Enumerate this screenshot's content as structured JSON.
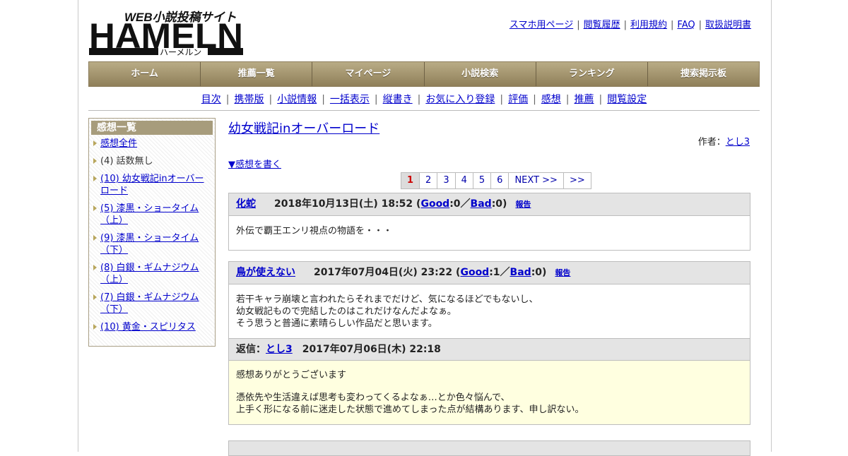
{
  "logo": {
    "text": "HAMELN",
    "tagline": "WEB小説投稿サイト",
    "kana": "ハーメルン"
  },
  "top_links": [
    "スマホ用ページ",
    "閲覧履歴",
    "利用規約",
    "FAQ",
    "取扱説明書"
  ],
  "global_nav": [
    "ホーム",
    "推薦一覧",
    "マイページ",
    "小説検索",
    "ランキング",
    "捜索掲示板"
  ],
  "sub_nav": [
    "目次",
    "携帯版",
    "小説情報",
    "一括表示",
    "縦書き",
    "お気に入り登録",
    "評価",
    "感想",
    "推薦",
    "閲覧設定"
  ],
  "sidebar": {
    "title": "感想一覧",
    "items": [
      {
        "label": "感想全件",
        "link": true
      },
      {
        "label": "(4) 話数無し",
        "link": false
      },
      {
        "label": "(10) 幼女戦記inオーバーロード",
        "link": true
      },
      {
        "label": "(5) 漆黒・ショータイム（上）",
        "link": true
      },
      {
        "label": "(9) 漆黒・ショータイム（下）",
        "link": true
      },
      {
        "label": "(8) 白銀・ギムナジウム（上）",
        "link": true
      },
      {
        "label": "(7) 白銀・ギムナジウム（下）",
        "link": true
      },
      {
        "label": "(10) 黄金・スピリタス",
        "link": true
      }
    ]
  },
  "main": {
    "novel_title": "幼女戦記inオーバーロード",
    "author_label": "作者：",
    "author_name": "とし3",
    "write_review": "▼感想を書く",
    "pager": [
      "1",
      "2",
      "3",
      "4",
      "5",
      "6",
      "NEXT >>",
      ">>"
    ],
    "pager_current": "1"
  },
  "reviews": [
    {
      "user": "化蛇",
      "date": "2018年10月13日(土) 18:52",
      "good_label": "Good",
      "good_count": ":0／",
      "bad_label": "Bad",
      "bad_count": ":0)",
      "report": "報告",
      "body": [
        "外伝で覇王エンリ視点の物語を・・・"
      ]
    },
    {
      "user": "鳥が使えない",
      "date": "2017年07月04日(火) 23:22",
      "good_label": "Good",
      "good_count": ":1／",
      "bad_label": "Bad",
      "bad_count": ":0)",
      "report": "報告",
      "body": [
        "若干キャラ崩壊と言われたらそれまでだけど、気になるほどでもないし、",
        "幼女戦記もので完結したのはこれだけなんだよなぁ。",
        "そう思うと普通に素晴らしい作品だと思います。"
      ],
      "reply": {
        "label": "返信：",
        "user": "とし3",
        "date": "2017年07月06日(木) 22:18",
        "lines": [
          "感想ありがとうございます",
          "",
          "憑依先や生活違えば思考も変わってくるよなぁ…とか色々悩んで、",
          "上手く形になる前に迷走した状態で進めてしまった点が結構あります、申し訳ない。"
        ]
      }
    }
  ],
  "colors": {
    "nav_bg": "#a3956f",
    "reply_bg": "#ffffe0",
    "header_gray": "#e4e4e4",
    "link": "#0000cc",
    "current_page": "#cc0000"
  }
}
